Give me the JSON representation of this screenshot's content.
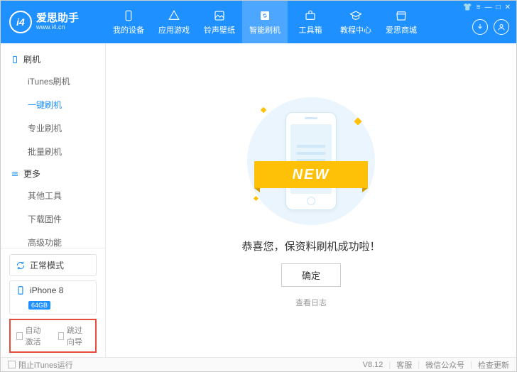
{
  "logo": {
    "badge": "i4",
    "title": "爱思助手",
    "sub": "www.i4.cn"
  },
  "nav": [
    {
      "label": "我的设备"
    },
    {
      "label": "应用游戏"
    },
    {
      "label": "铃声壁纸"
    },
    {
      "label": "智能刷机"
    },
    {
      "label": "工具箱"
    },
    {
      "label": "教程中心"
    },
    {
      "label": "爱思商城"
    }
  ],
  "sidebar": {
    "group1": "刷机",
    "items1": [
      "iTunes刷机",
      "一键刷机",
      "专业刷机",
      "批量刷机"
    ],
    "group2": "更多",
    "items2": [
      "其他工具",
      "下载固件",
      "高级功能"
    ],
    "status": "正常模式",
    "device": "iPhone 8",
    "storage": "64GB",
    "auto_activate": "自动激活",
    "skip_guide": "跳过向导"
  },
  "main": {
    "ribbon": "NEW",
    "message": "恭喜您，保资料刷机成功啦！",
    "ok": "确定",
    "view_log": "查看日志"
  },
  "statusbar": {
    "block_itunes": "阻止iTunes运行",
    "version": "V8.12",
    "support": "客服",
    "wechat": "微信公众号",
    "check_update": "检查更新"
  }
}
